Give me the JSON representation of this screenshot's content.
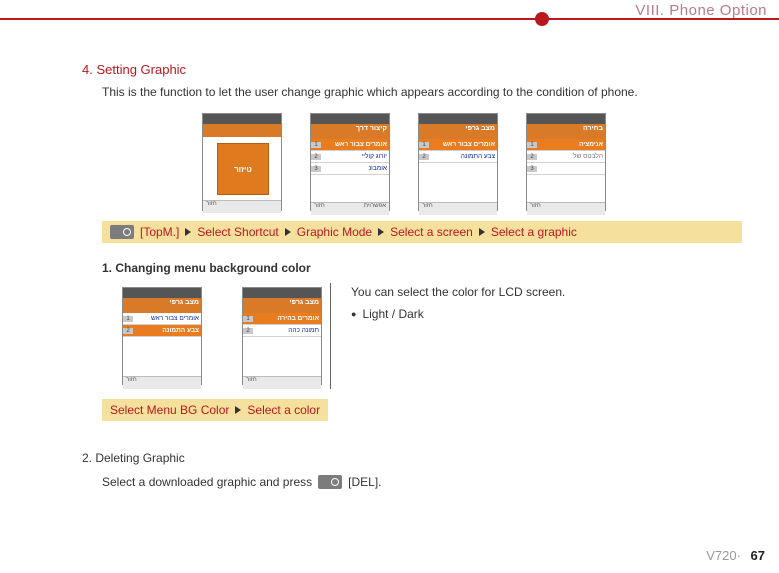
{
  "header": {
    "chapter": "VIII. Phone Option"
  },
  "section": {
    "number_title": "4. Setting Graphic",
    "intro": "This is the function to let the user change graphic which appears according to the condition of phone."
  },
  "breadcrumb1": {
    "items": [
      "[TopM.]",
      "Select Shortcut",
      "Graphic Mode",
      "Select a screen",
      "Select a graphic"
    ]
  },
  "sub1": {
    "title": "1. Changing menu background color",
    "desc": "You can select the color for LCD screen.",
    "bullet": "Light / Dark"
  },
  "breadcrumb2": {
    "items": [
      "Select Menu BG Color",
      "Select a color"
    ]
  },
  "sub2": {
    "title": "2. Deleting Graphic",
    "line_a": "Select a downloaded graphic and press",
    "line_b": "[DEL]."
  },
  "footer": {
    "model": "V720·",
    "page": "67"
  },
  "screens": {
    "big_icon_label": "טיזור",
    "s2_title": "קיצור דרך",
    "s2_rows": [
      "אומרים צבור ראש",
      "יורוג קוליי",
      "אומבונ"
    ],
    "s3_title": "מצב גרפי",
    "s3_rows": [
      "אומרים צבור ראש",
      "צבע התמונה"
    ],
    "s4_title": "בחירה",
    "s4_rows": [
      "אנימציה",
      "הלבטס של"
    ],
    "soft_left": "חזור",
    "soft_right": "אפשרוית",
    "pair1_title": "מצב גרפי",
    "pair1_rows": [
      "אומרים צבור ראש",
      "צבע התמונה"
    ],
    "pair2_title": "מצב גרפי",
    "pair2_rows": [
      "אומרים בהירה",
      "תמונה כהה"
    ]
  }
}
